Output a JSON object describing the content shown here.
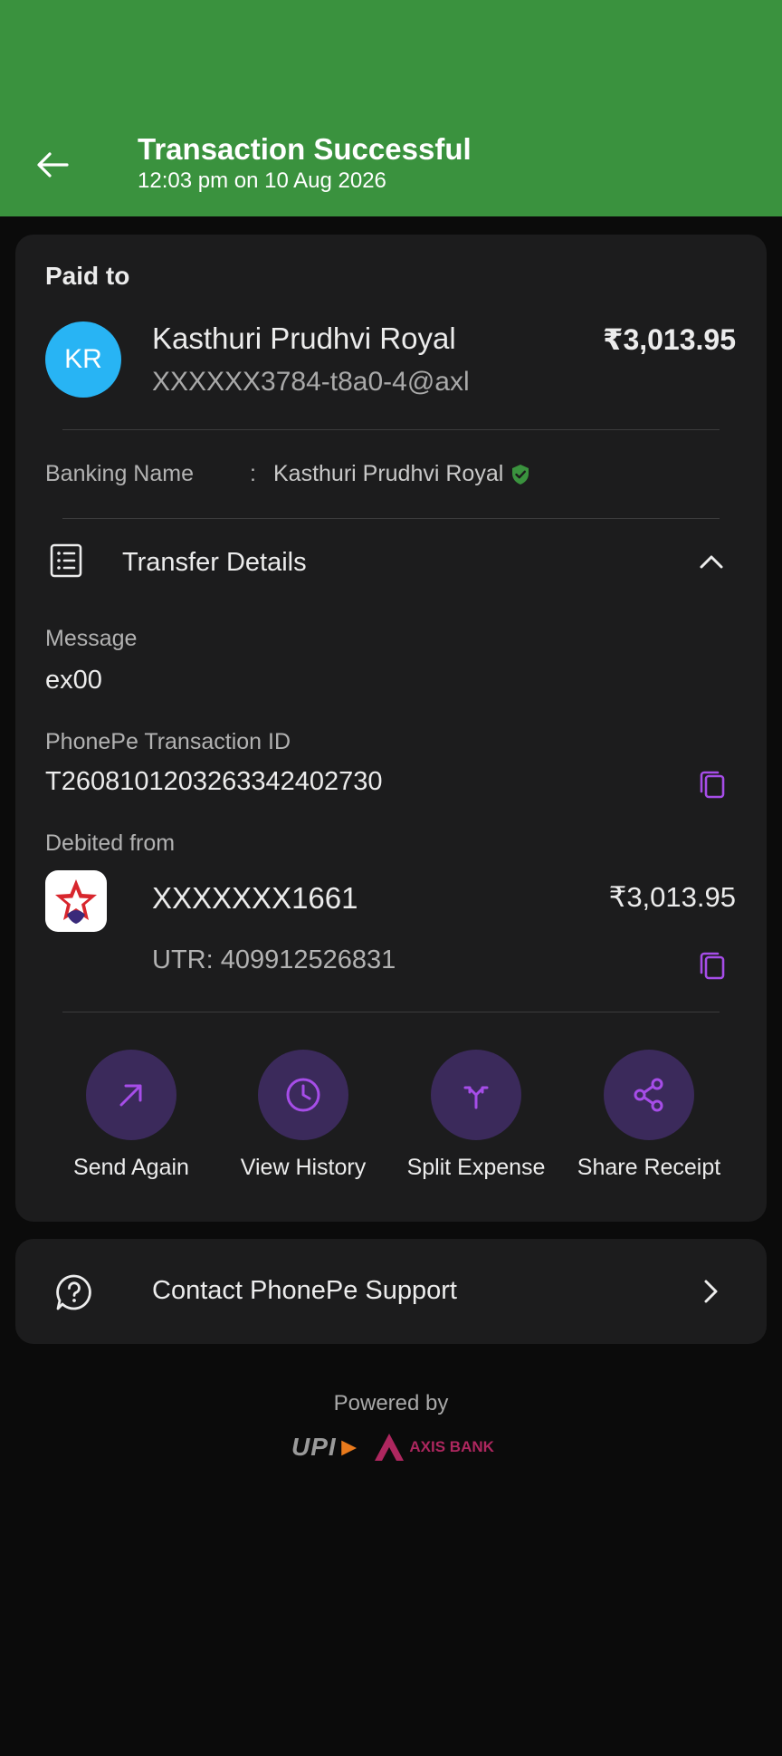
{
  "header": {
    "title": "Transaction Successful",
    "subtitle": "12:03 pm on 10 Aug 2026",
    "color": "#3a923e"
  },
  "paid": {
    "label": "Paid to",
    "initials": "KR",
    "name": "Kasthuri Prudhvi Royal",
    "upi_id": "XXXXXX3784-t8a0-4@axl",
    "amount": "₹3,013.95",
    "avatar_color": "#28b4f4"
  },
  "banking": {
    "label": "Banking Name",
    "colon": ":",
    "value": "Kasthuri Prudhvi Royal"
  },
  "transfer": {
    "label": "Transfer Details",
    "message_label": "Message",
    "message_value": "ex00",
    "txn_label": "PhonePe Transaction ID",
    "txn_value": "T2608101203263342402730",
    "debited_label": "Debited from",
    "account": "XXXXXXX1661",
    "account_amount": "₹3,013.95",
    "utr": "UTR: 409912526831"
  },
  "actions": [
    {
      "label": "Send Again",
      "icon": "arrow-up-right-icon"
    },
    {
      "label": "View History",
      "icon": "clock-icon"
    },
    {
      "label": "Split Expense",
      "icon": "split-icon"
    },
    {
      "label": "Share Receipt",
      "icon": "share-icon"
    }
  ],
  "support": {
    "label": "Contact PhonePe Support"
  },
  "footer": {
    "powered_by": "Powered by",
    "upi": "UPI",
    "bank": "AXIS BANK"
  },
  "colors": {
    "accent_purple": "#a64de8",
    "action_bg": "#3b2a5b",
    "card_bg": "#1c1c1d",
    "verified_green": "#3a923e"
  }
}
